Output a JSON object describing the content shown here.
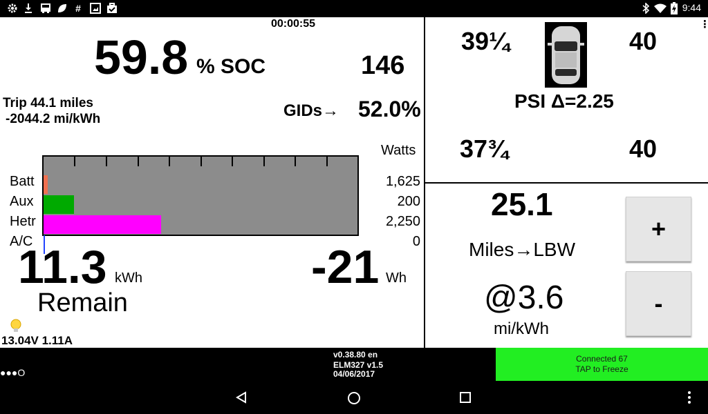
{
  "status_bar": {
    "time": "9:44",
    "left_icons": [
      "settings-icon",
      "download-icon",
      "bus-icon",
      "leaf-icon",
      "hash-icon",
      "gallery-icon",
      "briefcase-icon"
    ],
    "right_icons": [
      "bluetooth-icon",
      "wifi-icon",
      "battery-charging-icon"
    ]
  },
  "dashboard": {
    "timer": "00:00:55",
    "soc_value": "59.8",
    "soc_unit": "% SOC",
    "gids_value": "146",
    "trip_line1": "Trip  44.1 miles",
    "trip_line2": "-2044.2 mi/kWh",
    "gids_label": "GIDs→",
    "gids_percent": "52.0%"
  },
  "power_bars": {
    "watts_header": "Watts",
    "rows": [
      {
        "label": "Batt",
        "watts": "1,625",
        "fill_fraction": 0.013,
        "color": "#f07050"
      },
      {
        "label": "Aux",
        "watts": "200",
        "fill_fraction": 0.096,
        "color": "#00aa00"
      },
      {
        "label": "Hetr",
        "watts": "2,250",
        "fill_fraction": 0.375,
        "color": "#ff00ff"
      },
      {
        "label": "A/C",
        "watts": "0",
        "fill_fraction": 0.0,
        "color": "#2244ff"
      }
    ]
  },
  "energy": {
    "remain_value": "11.3",
    "remain_unit": "kWh",
    "remain_label": "Remain",
    "wh_value": "-21",
    "wh_unit": "Wh",
    "voltage_current": "13.04V 1.11A"
  },
  "tires": {
    "front_left": "39¼",
    "front_right": "40",
    "rear_left": "37¾",
    "rear_right": "40",
    "psi_label": "PSI  Δ=2.25"
  },
  "range": {
    "miles_value": "25.1",
    "miles_label": "Miles→LBW",
    "efficiency_value": "@3.6",
    "efficiency_unit": "mi/kWh",
    "plus_label": "+",
    "minus_label": "-"
  },
  "footer": {
    "version": "v0.38.80 en",
    "adapter": "ELM327 v1.5",
    "date": "04/06/2017",
    "dots": "●●●O",
    "connection_line1": "Connected 67",
    "connection_line2": "TAP to Freeze",
    "connection_color": "#22ee22"
  }
}
